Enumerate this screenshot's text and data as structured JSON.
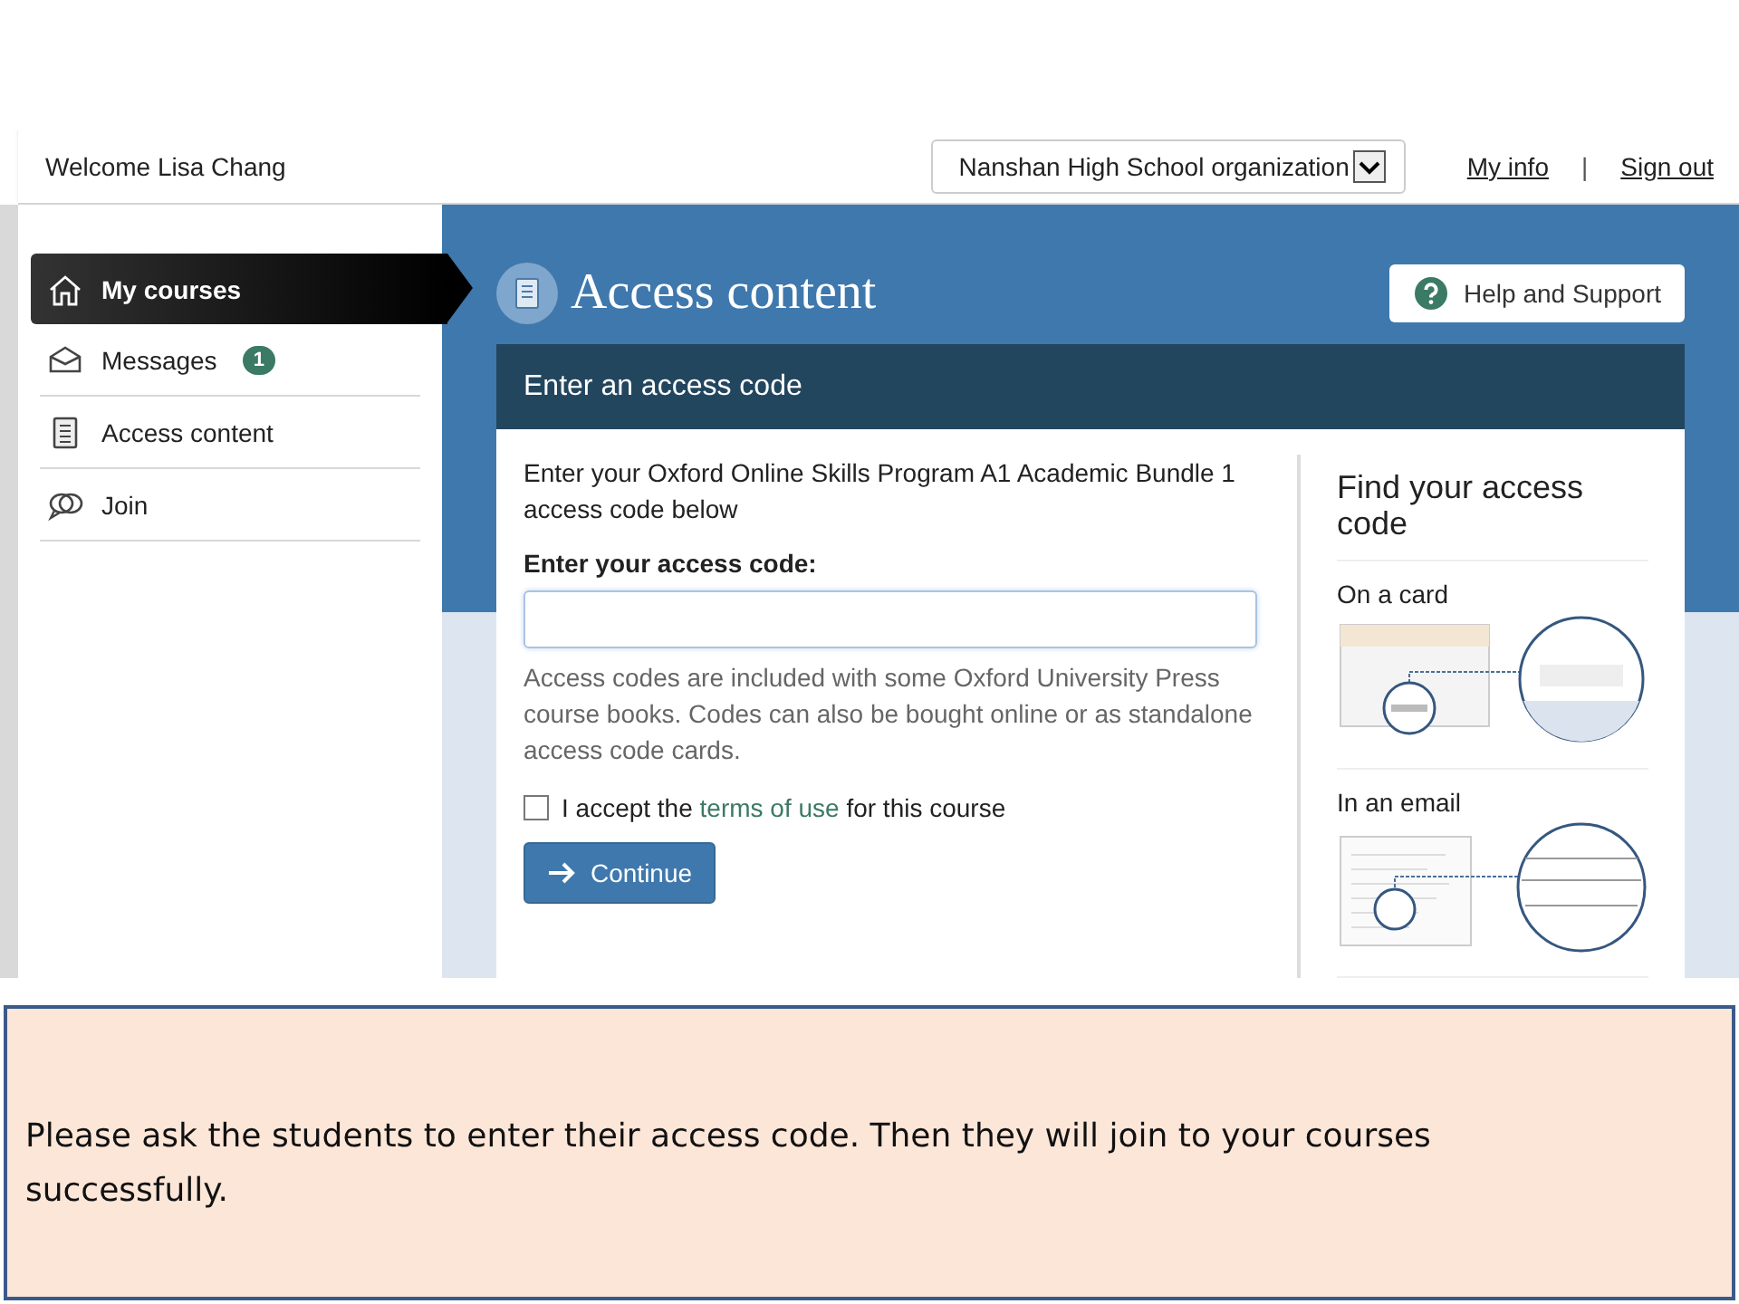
{
  "header": {
    "welcome": "Welcome Lisa Chang",
    "organization": "Nanshan High School organization",
    "links": [
      "My info",
      "Sign out"
    ],
    "separator": "|"
  },
  "sidebar": {
    "items": [
      {
        "label": "My courses",
        "selected": true
      },
      {
        "label": "Messages",
        "selected": false,
        "badge": "1"
      },
      {
        "label": "Access content",
        "selected": false
      },
      {
        "label": "Join",
        "selected": false
      }
    ]
  },
  "page": {
    "title": "Access content",
    "help_button": "Help and Support"
  },
  "panel": {
    "title": "Enter an access code",
    "intro": "Enter your Oxford Online Skills Program A1 Academic Bundle 1 access code below",
    "field_label": "Enter your access code:",
    "note": "Access codes are included with some Oxford University Press course books. Codes can also be bought online or as standalone access code cards.",
    "terms": {
      "checked": false,
      "before": "I accept the",
      "link": "terms of use",
      "after": "for this course"
    },
    "button": "Continue"
  },
  "aside": {
    "title": "Find your access code",
    "sections": [
      "On a card",
      "In an email"
    ]
  },
  "caption": "Please ask the students to enter their access code. Then they will join to your courses successfully."
}
